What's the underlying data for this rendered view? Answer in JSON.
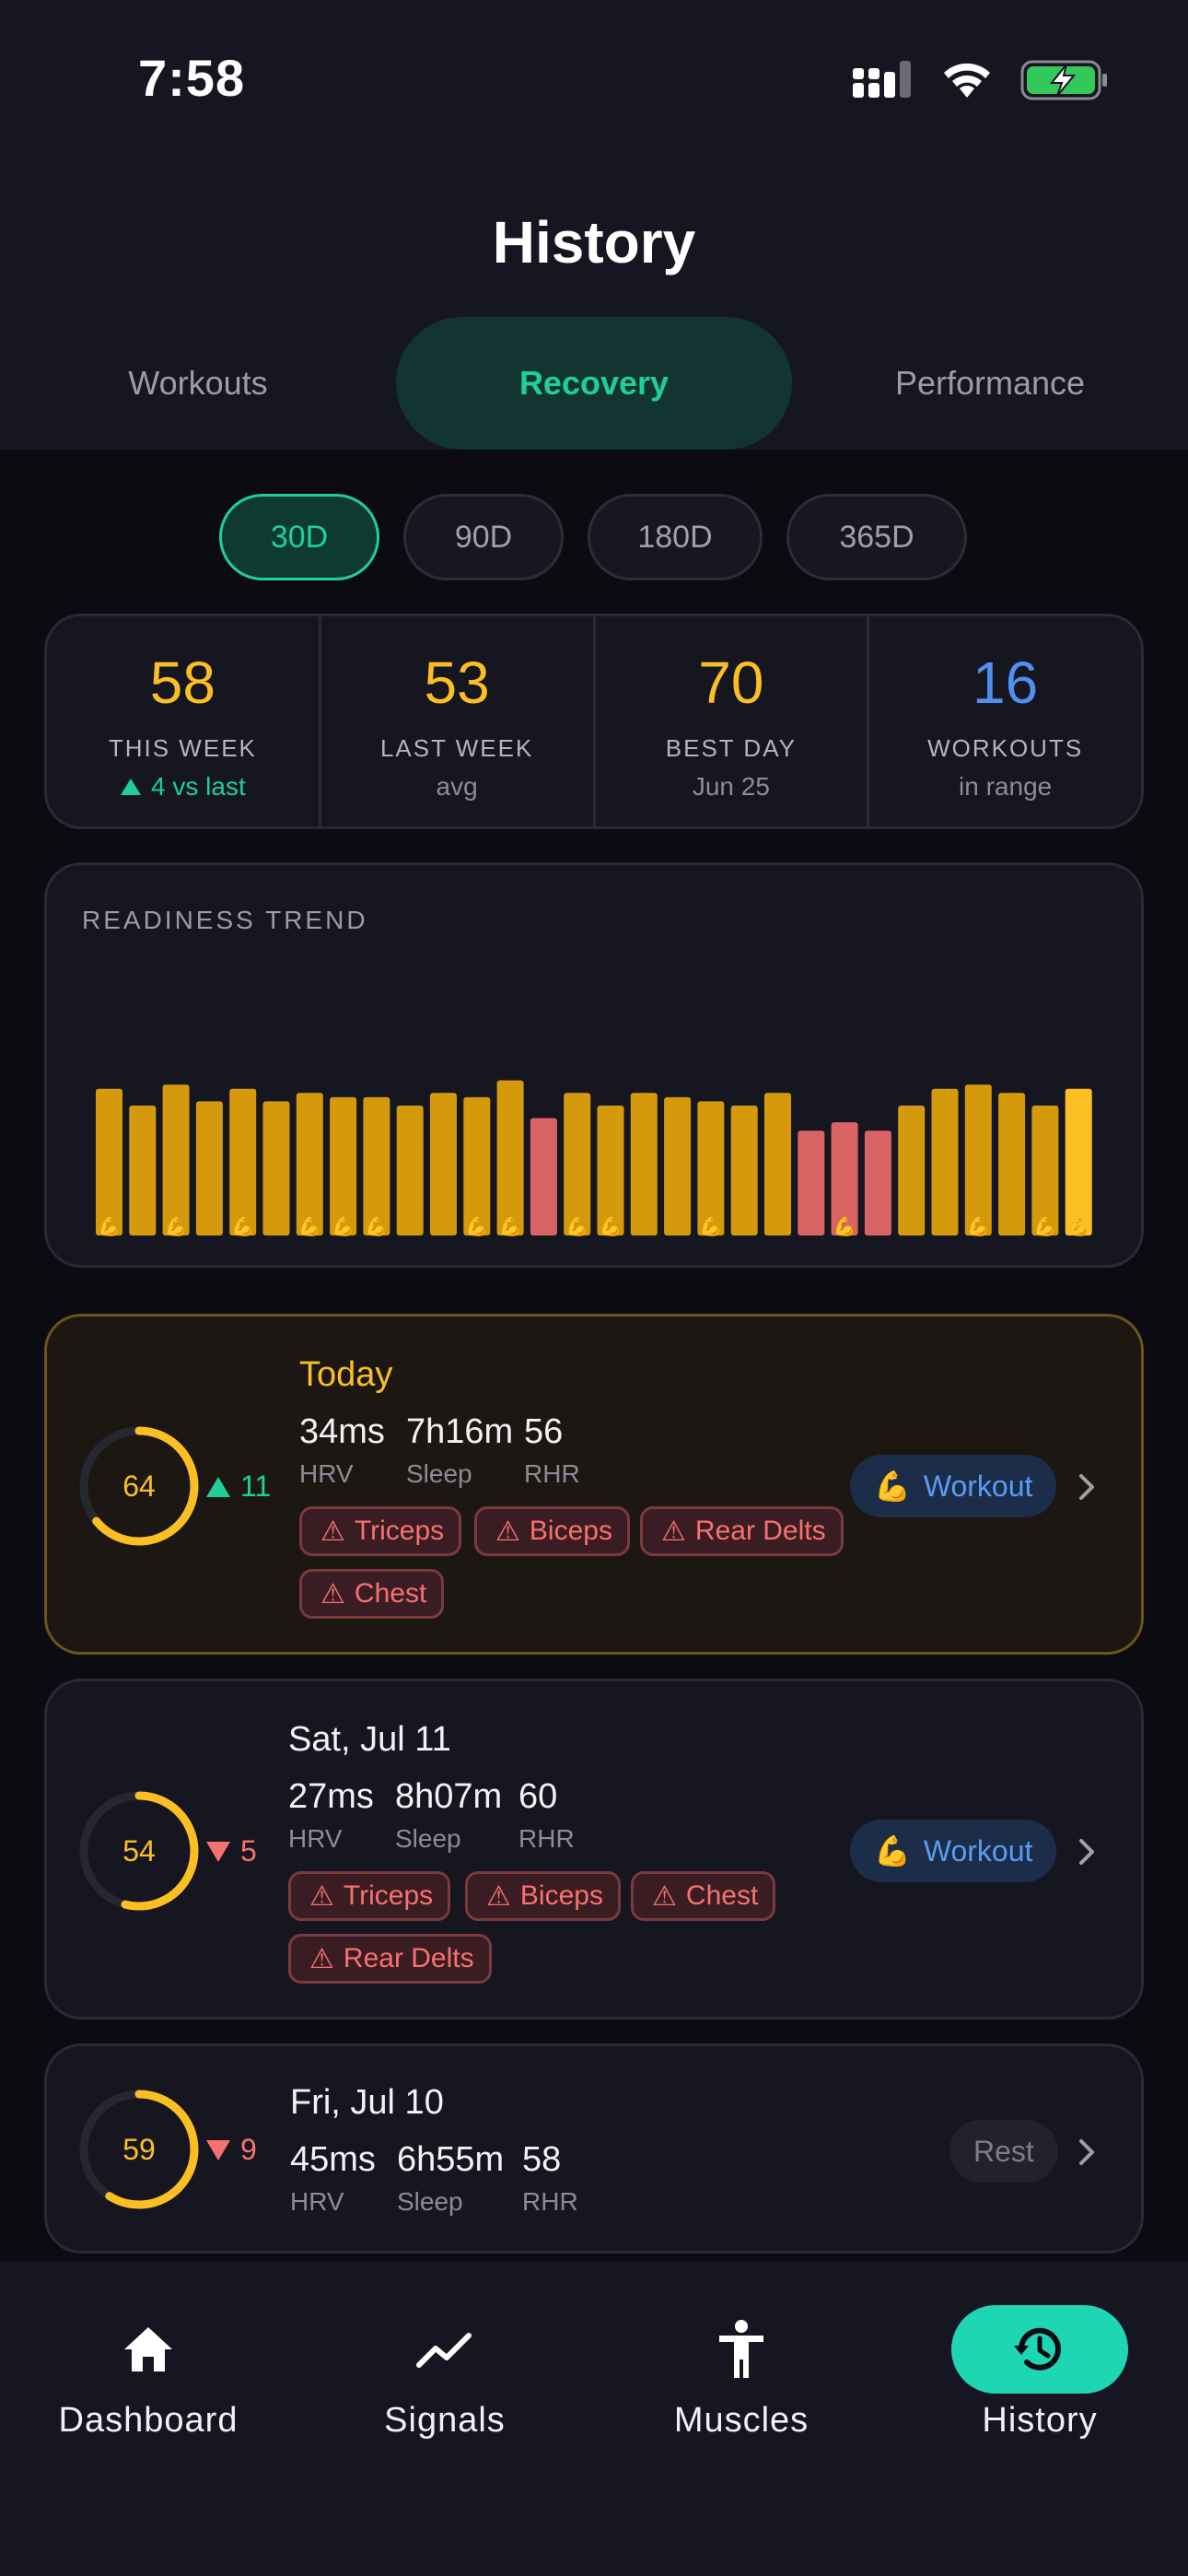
{
  "status": {
    "time": "7:58"
  },
  "header": {
    "title": "History"
  },
  "tabs": [
    {
      "label": "Workouts",
      "active": false
    },
    {
      "label": "Recovery",
      "active": true
    },
    {
      "label": "Performance",
      "active": false
    }
  ],
  "ranges": [
    {
      "label": "30D",
      "active": true
    },
    {
      "label": "90D",
      "active": false
    },
    {
      "label": "180D",
      "active": false
    },
    {
      "label": "365D",
      "active": false
    }
  ],
  "stats": [
    {
      "value": "58",
      "label": "THIS WEEK",
      "sub": "4 vs last",
      "color": "#fbbf24"
    },
    {
      "value": "53",
      "label": "LAST WEEK",
      "sub": "avg",
      "color": "#fbbf24"
    },
    {
      "value": "70",
      "label": "BEST DAY",
      "sub": "Jun 25",
      "color": "#fbbf24"
    },
    {
      "value": "16",
      "label": "WORKOUTS",
      "sub": "in range",
      "color": "#4f90f0"
    }
  ],
  "trend": {
    "title": "READINESS TREND"
  },
  "chart_data": {
    "type": "bar",
    "title": "READINESS TREND",
    "values": [
      65,
      61,
      66,
      62,
      65,
      62,
      64,
      63,
      63,
      61,
      64,
      63,
      67,
      58,
      64,
      61,
      64,
      63,
      62,
      61,
      64,
      55,
      57,
      55,
      61,
      65,
      66,
      64,
      61,
      65
    ],
    "colors": [
      "amber",
      "amber",
      "amber",
      "amber",
      "amber",
      "amber",
      "amber",
      "amber",
      "amber",
      "amber",
      "amber",
      "amber",
      "amber",
      "red",
      "amber",
      "amber",
      "amber",
      "amber",
      "amber",
      "amber",
      "amber",
      "red",
      "red",
      "red",
      "amber",
      "amber",
      "amber",
      "amber",
      "amber",
      "amber"
    ],
    "workout_marker": [
      true,
      false,
      true,
      false,
      true,
      false,
      true,
      true,
      true,
      false,
      false,
      true,
      true,
      false,
      true,
      true,
      false,
      false,
      true,
      false,
      false,
      false,
      true,
      false,
      false,
      false,
      true,
      false,
      true,
      true
    ],
    "ylim": [
      30,
      70
    ],
    "palette": {
      "amber": "#d49a0c",
      "red": "#d96464",
      "today": "#fbbf24"
    }
  },
  "days": [
    {
      "title": "Today",
      "score": "64",
      "score_pct": 0.64,
      "delta": "11",
      "direction": "up",
      "metrics": [
        {
          "value": "34ms",
          "label": "HRV"
        },
        {
          "value": "7h16m",
          "label": "Sleep"
        },
        {
          "value": "56",
          "label": "RHR"
        }
      ],
      "tags": [
        "Triceps",
        "Biceps",
        "Rear Delts",
        "Chest"
      ],
      "action": "Workout",
      "action_type": "workout"
    },
    {
      "title": "Sat, Jul 11",
      "score": "54",
      "score_pct": 0.54,
      "delta": "5",
      "direction": "down",
      "metrics": [
        {
          "value": "27ms",
          "label": "HRV"
        },
        {
          "value": "8h07m",
          "label": "Sleep"
        },
        {
          "value": "60",
          "label": "RHR"
        }
      ],
      "tags": [
        "Triceps",
        "Biceps",
        "Chest",
        "Rear Delts"
      ],
      "action": "Workout",
      "action_type": "workout"
    },
    {
      "title": "Fri, Jul 10",
      "score": "59",
      "score_pct": 0.59,
      "delta": "9",
      "direction": "down",
      "metrics": [
        {
          "value": "45ms",
          "label": "HRV"
        },
        {
          "value": "6h55m",
          "label": "Sleep"
        },
        {
          "value": "58",
          "label": "RHR"
        }
      ],
      "tags": [],
      "action": "Rest",
      "action_type": "rest"
    }
  ],
  "nav": [
    {
      "label": "Dashboard",
      "icon": "home-icon",
      "active": false
    },
    {
      "label": "Signals",
      "icon": "trend-icon",
      "active": false
    },
    {
      "label": "Muscles",
      "icon": "person-icon",
      "active": false
    },
    {
      "label": "History",
      "icon": "history-icon",
      "active": true
    }
  ]
}
